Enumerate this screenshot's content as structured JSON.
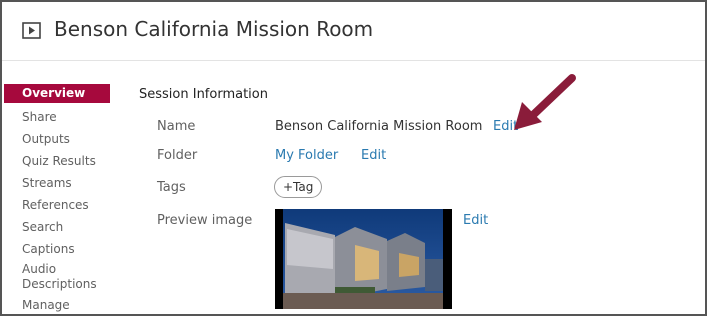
{
  "header": {
    "title": "Benson California Mission Room",
    "icon": "video-play-icon"
  },
  "sidebar": {
    "items": [
      {
        "label": "Overview",
        "active": true
      },
      {
        "label": "Share"
      },
      {
        "label": "Outputs"
      },
      {
        "label": "Quiz Results"
      },
      {
        "label": "Streams"
      },
      {
        "label": "References"
      },
      {
        "label": "Search"
      },
      {
        "label": "Captions"
      },
      {
        "label": "Audio Descriptions"
      },
      {
        "label": "Manage"
      }
    ]
  },
  "session": {
    "section_title": "Session Information",
    "name_label": "Name",
    "name_value": "Benson California Mission Room",
    "name_edit": "Edit",
    "folder_label": "Folder",
    "folder_value": "My Folder",
    "folder_edit": "Edit",
    "tags_label": "Tags",
    "tag_button": "+Tag",
    "preview_label": "Preview image",
    "preview_edit": "Edit"
  },
  "colors": {
    "accent": "#a6093d",
    "link": "#2a7ab0",
    "arrow": "#8a1c3a"
  }
}
